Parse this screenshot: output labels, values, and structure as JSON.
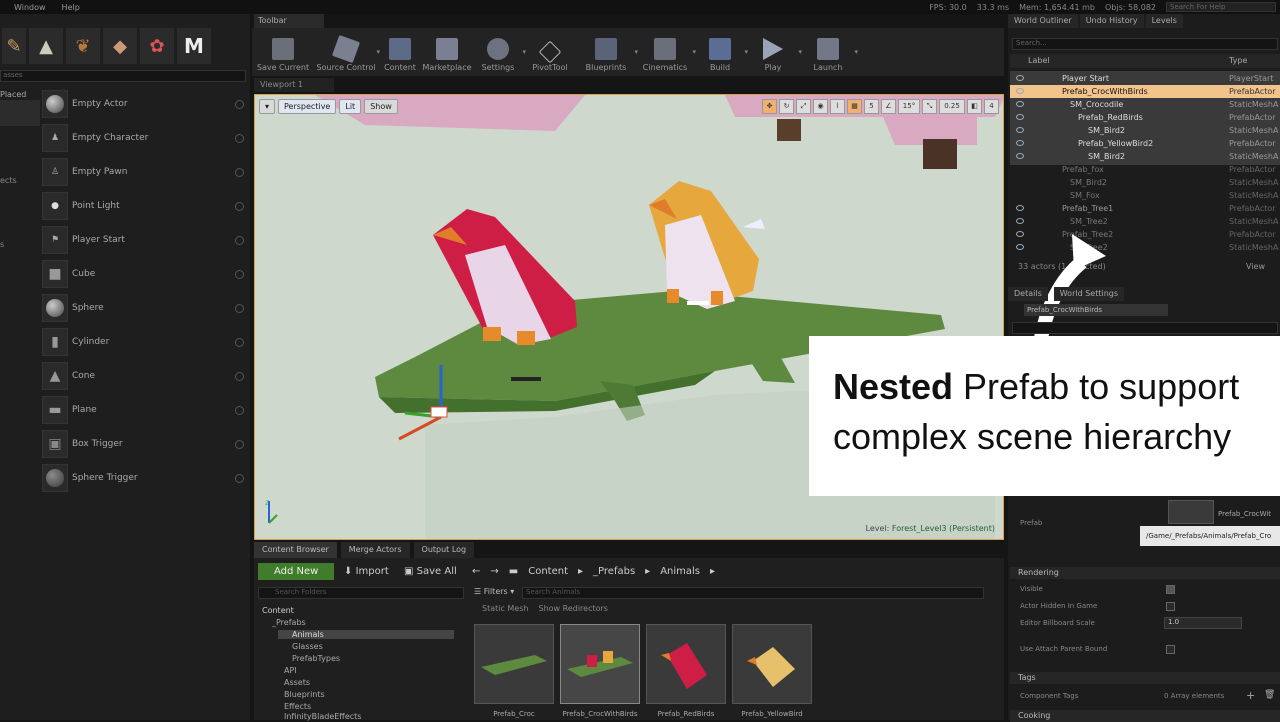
{
  "menu": {
    "items": [
      "Window",
      "Help"
    ],
    "fps": "FPS: 30.0",
    "ms": "33.3 ms",
    "mem": "Mem: 1,654.41 mb",
    "objs": "Objs: 58,082",
    "help_placeholder": "Search For Help"
  },
  "left": {
    "search_placeholder": "asses",
    "categories": [
      "Placed",
      "ects",
      "s"
    ],
    "items": [
      "Empty Actor",
      "Empty Character",
      "Empty Pawn",
      "Point Light",
      "Player Start",
      "Cube",
      "Sphere",
      "Cylinder",
      "Cone",
      "Plane",
      "Box Trigger",
      "Sphere Trigger"
    ]
  },
  "toolbar": {
    "tab": "Toolbar",
    "tools": [
      "Save Current",
      "Source Control",
      "Content",
      "Marketplace",
      "Settings",
      "PivotTool",
      "Blueprints",
      "Cinematics",
      "Build",
      "Play",
      "Launch"
    ]
  },
  "viewport": {
    "tab": "Viewport 1",
    "perspective": "Perspective",
    "lit": "Lit",
    "show": "Show",
    "snap1": "5",
    "snap2": "15°",
    "snap3": "0.25",
    "cam": "4",
    "level_label": "Level:",
    "level_name": "Forest_Level3 (Persistent)"
  },
  "outliner": {
    "tabs": [
      "World Outliner",
      "Undo History",
      "Levels"
    ],
    "search_placeholder": "Search...",
    "col_label": "Label",
    "col_type": "Type",
    "rows": [
      {
        "label": "Player Start",
        "type": "PlayerStart"
      },
      {
        "label": "Prefab_CrocWithBirds",
        "type": "PrefabActor"
      },
      {
        "label": "SM_Crocodile",
        "type": "StaticMeshA"
      },
      {
        "label": "Prefab_RedBirds",
        "type": "PrefabActor"
      },
      {
        "label": "SM_Bird2",
        "type": "StaticMeshA"
      },
      {
        "label": "Prefab_YellowBird2",
        "type": "PrefabActor"
      },
      {
        "label": "SM_Bird2",
        "type": "StaticMeshA"
      },
      {
        "label": "Prefab_fox",
        "type": "PrefabActor"
      },
      {
        "label": "SM_Bird2",
        "type": "StaticMeshA"
      },
      {
        "label": "SM_Fox",
        "type": "StaticMeshA"
      },
      {
        "label": "Prefab_Tree1",
        "type": "PrefabActor"
      },
      {
        "label": "SM_Tree2",
        "type": "StaticMeshA"
      },
      {
        "label": "Prefab_Tree2",
        "type": "PrefabActor"
      },
      {
        "label": "SM_Tree2",
        "type": "StaticMeshA"
      }
    ],
    "status": "33 actors (1 selected)",
    "view": "View"
  },
  "details": {
    "tabs": [
      "Details",
      "World Settings"
    ],
    "name": "Prefab_CrocWithBirds",
    "prefab_label": "Prefab",
    "prefab_value": "Prefab_CrocWit",
    "prefab_path": "/Game/_Prefabs/Animals/Prefab_Cro",
    "rendering": "Rendering",
    "visible": "Visible",
    "hidden_in_game": "Actor Hidden In Game",
    "billboard_scale": "Editor Billboard Scale",
    "billboard_value": "1.0",
    "attach_bound": "Use Attach Parent Bound",
    "tags": "Tags",
    "component_tags": "Component Tags",
    "array_elements": "0 Array elements",
    "cooking": "Cooking"
  },
  "callout": {
    "bold": "Nested",
    "line1_rest": " Prefab to support",
    "line2": "complex scene hierarchy"
  },
  "content": {
    "tabs": [
      "Content Browser",
      "Merge Actors",
      "Output Log"
    ],
    "add_new": "Add New",
    "import": "Import",
    "save_all": "Save All",
    "crumbs": [
      "Content",
      "_Prefabs",
      "Animals"
    ],
    "folder_placeholder": "Search Folders",
    "filters": "Filters",
    "asset_placeholder": "Search Animals",
    "chips": [
      "Static Mesh",
      "Show Redirectors"
    ],
    "tree": [
      "Content",
      "_Prefabs",
      "Animals",
      "Glasses",
      "PrefabTypes",
      "API",
      "Assets",
      "Blueprints",
      "Effects",
      "InfinityBladeEffects"
    ],
    "assets": [
      "Prefab_Croc",
      "Prefab_CrocWithBirds",
      "Prefab_RedBirds",
      "Prefab_YellowBird"
    ]
  },
  "colors": {
    "accent": "#d8a14a",
    "add_new": "#3f7d2a",
    "selected_row": "#f2c48c"
  }
}
